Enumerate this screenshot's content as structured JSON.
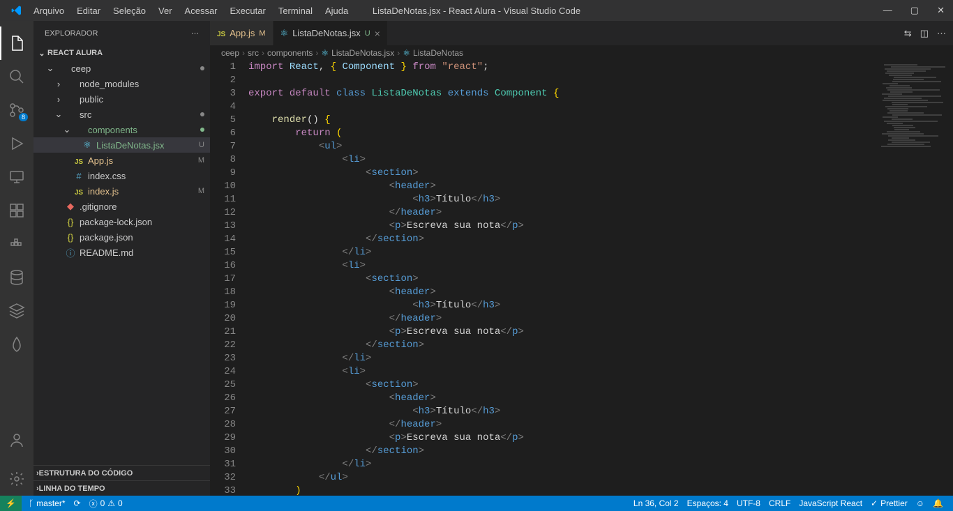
{
  "title": "ListaDeNotas.jsx - React Alura - Visual Studio Code",
  "menu": [
    "Arquivo",
    "Editar",
    "Seleção",
    "Ver",
    "Acessar",
    "Executar",
    "Terminal",
    "Ajuda"
  ],
  "activity": {
    "scm_badge": "8"
  },
  "sidebar": {
    "title": "Explorador",
    "project": "REACT ALURA",
    "outline": "Estrutura do Código",
    "timeline": "Linha do Tempo",
    "tree": [
      {
        "label": "ceep",
        "indent": 1,
        "chev": "⌄",
        "cls": "c-folder",
        "dot": true
      },
      {
        "label": "node_modules",
        "indent": 2,
        "chev": "›",
        "cls": "c-folder"
      },
      {
        "label": "public",
        "indent": 2,
        "chev": "›",
        "cls": "c-folder"
      },
      {
        "label": "src",
        "indent": 2,
        "chev": "⌄",
        "cls": "c-folder",
        "dot": true
      },
      {
        "label": "components",
        "indent": 3,
        "chev": "⌄",
        "cls": "c-green",
        "dot_green": true
      },
      {
        "label": "ListaDeNotas.jsx",
        "indent": 4,
        "icon": "react",
        "cls": "c-green",
        "status": "U",
        "active": true
      },
      {
        "label": "App.js",
        "indent": 3,
        "icon": "js",
        "cls": "c-yellow",
        "status": "M"
      },
      {
        "label": "index.css",
        "indent": 3,
        "icon": "css",
        "cls": "c-normal"
      },
      {
        "label": "index.js",
        "indent": 3,
        "icon": "js",
        "cls": "c-yellow",
        "status": "M"
      },
      {
        "label": ".gitignore",
        "indent": 2,
        "icon": "git",
        "cls": "c-normal"
      },
      {
        "label": "package-lock.json",
        "indent": 2,
        "icon": "json",
        "cls": "c-normal"
      },
      {
        "label": "package.json",
        "indent": 2,
        "icon": "json",
        "cls": "c-normal"
      },
      {
        "label": "README.md",
        "indent": 2,
        "icon": "info",
        "cls": "c-normal"
      }
    ]
  },
  "tabs": [
    {
      "icon": "js",
      "label": "App.js",
      "status": "M",
      "status_cls": "c-yellow",
      "active": false
    },
    {
      "icon": "react",
      "label": "ListaDeNotas.jsx",
      "status": "U",
      "status_cls": "c-green",
      "active": true,
      "close": true
    }
  ],
  "breadcrumbs": [
    "ceep",
    "src",
    "components",
    "ListaDeNotas.jsx",
    "ListaDeNotas"
  ],
  "bc_last_icon": "react",
  "code_lines": [
    [
      [
        "key",
        "import"
      ],
      [
        "punc",
        " "
      ],
      [
        "var",
        "React"
      ],
      [
        "punc",
        ", "
      ],
      [
        "brace",
        "{"
      ],
      [
        "punc",
        " "
      ],
      [
        "var",
        "Component"
      ],
      [
        "punc",
        " "
      ],
      [
        "brace",
        "}"
      ],
      [
        "punc",
        " "
      ],
      [
        "key",
        "from"
      ],
      [
        "punc",
        " "
      ],
      [
        "str",
        "\"react\""
      ],
      [
        "punc",
        ";"
      ]
    ],
    [],
    [
      [
        "key",
        "export"
      ],
      [
        "punc",
        " "
      ],
      [
        "key",
        "default"
      ],
      [
        "punc",
        " "
      ],
      [
        "storage",
        "class"
      ],
      [
        "punc",
        " "
      ],
      [
        "type",
        "ListaDeNotas"
      ],
      [
        "punc",
        " "
      ],
      [
        "storage",
        "extends"
      ],
      [
        "punc",
        " "
      ],
      [
        "type",
        "Component"
      ],
      [
        "punc",
        " "
      ],
      [
        "brace",
        "{"
      ]
    ],
    [],
    [
      [
        "punc",
        "    "
      ],
      [
        "func",
        "render"
      ],
      [
        "punc",
        "() "
      ],
      [
        "brace",
        "{"
      ]
    ],
    [
      [
        "punc",
        "        "
      ],
      [
        "key",
        "return"
      ],
      [
        "punc",
        " "
      ],
      [
        "brace",
        "("
      ]
    ],
    [
      [
        "punc",
        "            "
      ],
      [
        "ang",
        "<"
      ],
      [
        "tag",
        "ul"
      ],
      [
        "ang",
        ">"
      ]
    ],
    [
      [
        "punc",
        "                "
      ],
      [
        "ang",
        "<"
      ],
      [
        "tag",
        "li"
      ],
      [
        "ang",
        ">"
      ]
    ],
    [
      [
        "punc",
        "                    "
      ],
      [
        "ang",
        "<"
      ],
      [
        "tag",
        "section"
      ],
      [
        "ang",
        ">"
      ]
    ],
    [
      [
        "punc",
        "                        "
      ],
      [
        "ang",
        "<"
      ],
      [
        "tag",
        "header"
      ],
      [
        "ang",
        ">"
      ]
    ],
    [
      [
        "punc",
        "                            "
      ],
      [
        "ang",
        "<"
      ],
      [
        "tag",
        "h3"
      ],
      [
        "ang",
        ">"
      ],
      [
        "text",
        "Título"
      ],
      [
        "ang",
        "</"
      ],
      [
        "tag",
        "h3"
      ],
      [
        "ang",
        ">"
      ]
    ],
    [
      [
        "punc",
        "                        "
      ],
      [
        "ang",
        "</"
      ],
      [
        "tag",
        "header"
      ],
      [
        "ang",
        ">"
      ]
    ],
    [
      [
        "punc",
        "                        "
      ],
      [
        "ang",
        "<"
      ],
      [
        "tag",
        "p"
      ],
      [
        "ang",
        ">"
      ],
      [
        "text",
        "Escreva sua nota"
      ],
      [
        "ang",
        "</"
      ],
      [
        "tag",
        "p"
      ],
      [
        "ang",
        ">"
      ]
    ],
    [
      [
        "punc",
        "                    "
      ],
      [
        "ang",
        "</"
      ],
      [
        "tag",
        "section"
      ],
      [
        "ang",
        ">"
      ]
    ],
    [
      [
        "punc",
        "                "
      ],
      [
        "ang",
        "</"
      ],
      [
        "tag",
        "li"
      ],
      [
        "ang",
        ">"
      ]
    ],
    [
      [
        "punc",
        "                "
      ],
      [
        "ang",
        "<"
      ],
      [
        "tag",
        "li"
      ],
      [
        "ang",
        ">"
      ]
    ],
    [
      [
        "punc",
        "                    "
      ],
      [
        "ang",
        "<"
      ],
      [
        "tag",
        "section"
      ],
      [
        "ang",
        ">"
      ]
    ],
    [
      [
        "punc",
        "                        "
      ],
      [
        "ang",
        "<"
      ],
      [
        "tag",
        "header"
      ],
      [
        "ang",
        ">"
      ]
    ],
    [
      [
        "punc",
        "                            "
      ],
      [
        "ang",
        "<"
      ],
      [
        "tag",
        "h3"
      ],
      [
        "ang",
        ">"
      ],
      [
        "text",
        "Título"
      ],
      [
        "ang",
        "</"
      ],
      [
        "tag",
        "h3"
      ],
      [
        "ang",
        ">"
      ]
    ],
    [
      [
        "punc",
        "                        "
      ],
      [
        "ang",
        "</"
      ],
      [
        "tag",
        "header"
      ],
      [
        "ang",
        ">"
      ]
    ],
    [
      [
        "punc",
        "                        "
      ],
      [
        "ang",
        "<"
      ],
      [
        "tag",
        "p"
      ],
      [
        "ang",
        ">"
      ],
      [
        "text",
        "Escreva sua nota"
      ],
      [
        "ang",
        "</"
      ],
      [
        "tag",
        "p"
      ],
      [
        "ang",
        ">"
      ]
    ],
    [
      [
        "punc",
        "                    "
      ],
      [
        "ang",
        "</"
      ],
      [
        "tag",
        "section"
      ],
      [
        "ang",
        ">"
      ]
    ],
    [
      [
        "punc",
        "                "
      ],
      [
        "ang",
        "</"
      ],
      [
        "tag",
        "li"
      ],
      [
        "ang",
        ">"
      ]
    ],
    [
      [
        "punc",
        "                "
      ],
      [
        "ang",
        "<"
      ],
      [
        "tag",
        "li"
      ],
      [
        "ang",
        ">"
      ]
    ],
    [
      [
        "punc",
        "                    "
      ],
      [
        "ang",
        "<"
      ],
      [
        "tag",
        "section"
      ],
      [
        "ang",
        ">"
      ]
    ],
    [
      [
        "punc",
        "                        "
      ],
      [
        "ang",
        "<"
      ],
      [
        "tag",
        "header"
      ],
      [
        "ang",
        ">"
      ]
    ],
    [
      [
        "punc",
        "                            "
      ],
      [
        "ang",
        "<"
      ],
      [
        "tag",
        "h3"
      ],
      [
        "ang",
        ">"
      ],
      [
        "text",
        "Título"
      ],
      [
        "ang",
        "</"
      ],
      [
        "tag",
        "h3"
      ],
      [
        "ang",
        ">"
      ]
    ],
    [
      [
        "punc",
        "                        "
      ],
      [
        "ang",
        "</"
      ],
      [
        "tag",
        "header"
      ],
      [
        "ang",
        ">"
      ]
    ],
    [
      [
        "punc",
        "                        "
      ],
      [
        "ang",
        "<"
      ],
      [
        "tag",
        "p"
      ],
      [
        "ang",
        ">"
      ],
      [
        "text",
        "Escreva sua nota"
      ],
      [
        "ang",
        "</"
      ],
      [
        "tag",
        "p"
      ],
      [
        "ang",
        ">"
      ]
    ],
    [
      [
        "punc",
        "                    "
      ],
      [
        "ang",
        "</"
      ],
      [
        "tag",
        "section"
      ],
      [
        "ang",
        ">"
      ]
    ],
    [
      [
        "punc",
        "                "
      ],
      [
        "ang",
        "</"
      ],
      [
        "tag",
        "li"
      ],
      [
        "ang",
        ">"
      ]
    ],
    [
      [
        "punc",
        "            "
      ],
      [
        "ang",
        "</"
      ],
      [
        "tag",
        "ul"
      ],
      [
        "ang",
        ">"
      ]
    ],
    [
      [
        "punc",
        "        "
      ],
      [
        "brace",
        ")"
      ]
    ]
  ],
  "statusbar": {
    "branch": "master*",
    "sync": "⟳",
    "errors": "0",
    "warnings": "0",
    "lncol": "Ln 36, Col 2",
    "spaces": "Espaços: 4",
    "encoding": "UTF-8",
    "eol": "CRLF",
    "lang": "JavaScript React",
    "prettier": "Prettier",
    "feedback": "☺"
  }
}
